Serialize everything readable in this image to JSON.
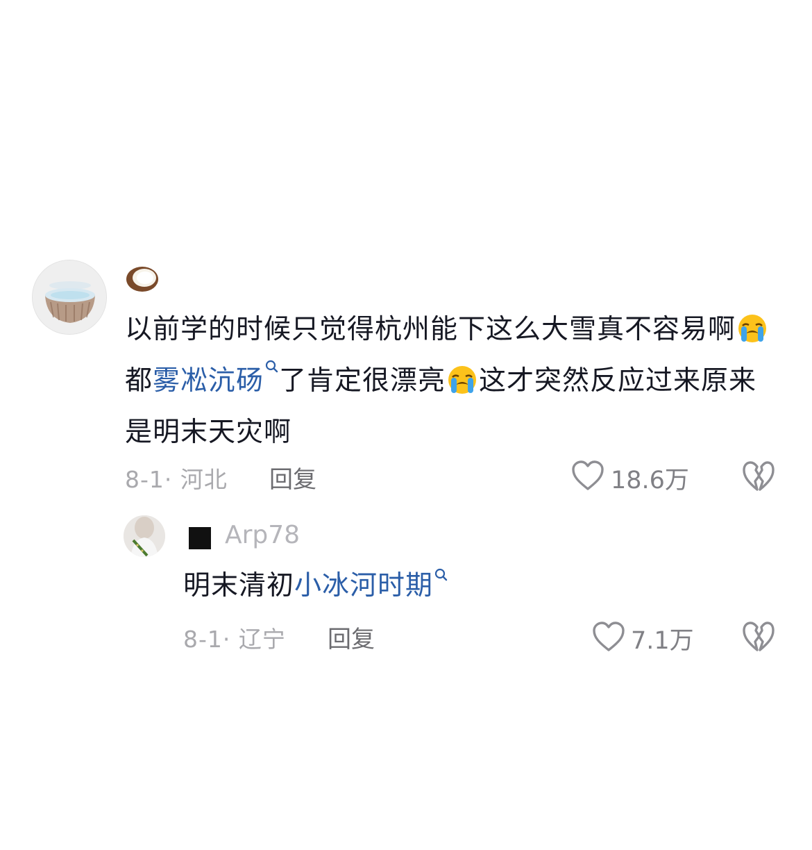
{
  "comments": [
    {
      "name_emoji": "coconut-emoji",
      "text_parts": {
        "p1": "以前学的时候只觉得杭州能下这么大雪真不容易啊",
        "p2": "都",
        "link1": "雾凇沆砀",
        "p3": "了肯定很漂亮",
        "p4": "这才突然反应过来原来是明末天灾啊"
      },
      "date_location": "8-1· 河北",
      "reply_label": "回复",
      "like_count": "18.6万"
    },
    {
      "username": "Arp78",
      "text": "明末清初",
      "link": "小冰河时期",
      "date_location": "8-1· 辽宁",
      "reply_label": "回复",
      "like_count": "7.1万"
    }
  ],
  "colors": {
    "link": "#2b5ea8",
    "text": "#161823",
    "meta": "#a9a9ad"
  },
  "icons": [
    "heart-outline-icon",
    "broken-heart-icon",
    "search-icon",
    "crying-face-emoji"
  ]
}
